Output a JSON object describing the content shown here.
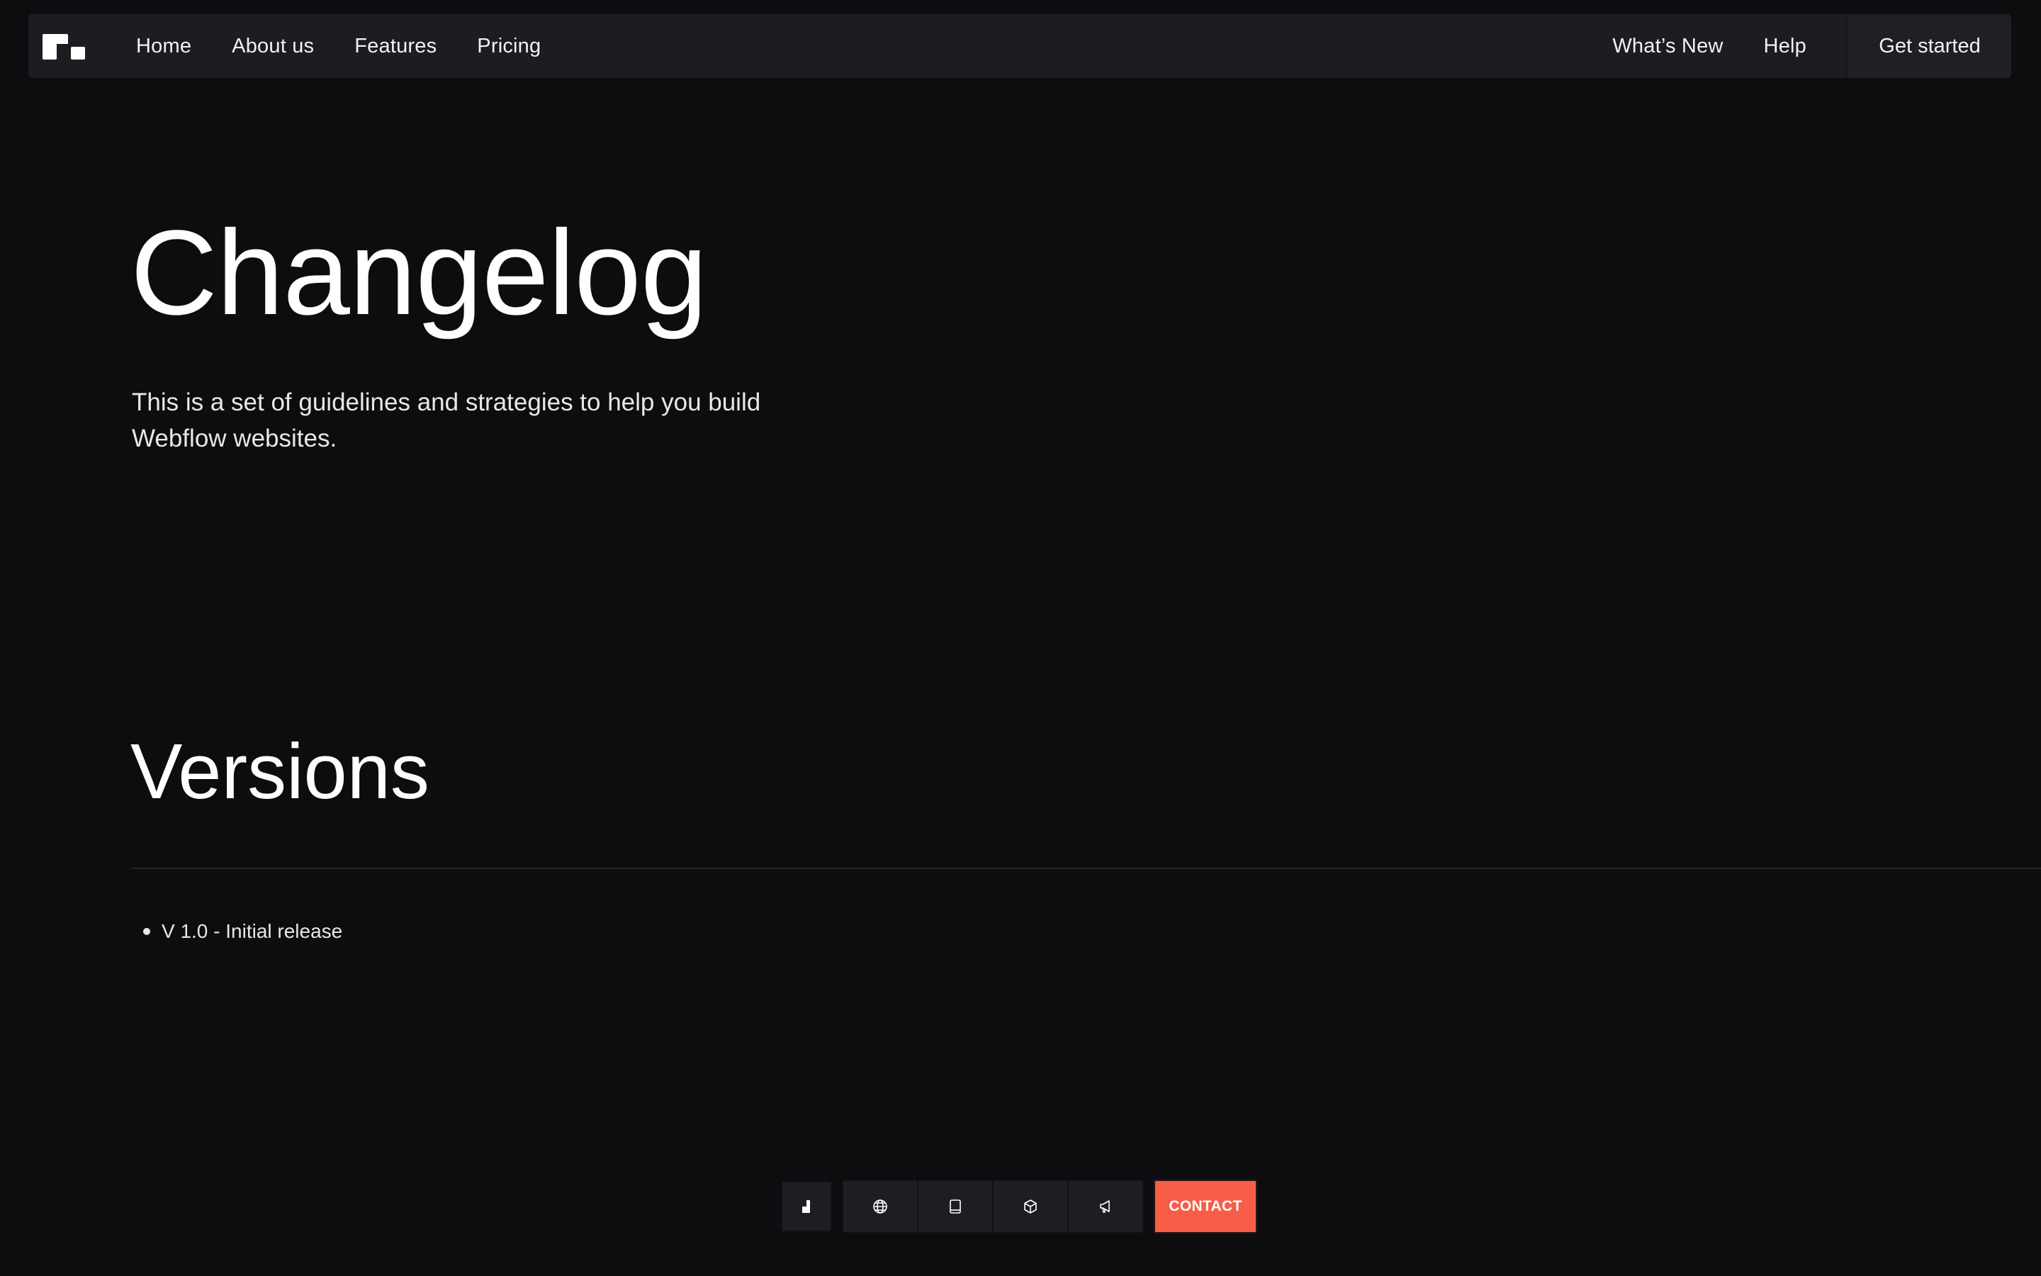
{
  "nav": {
    "left_links": [
      "Home",
      "About us",
      "Features",
      "Pricing"
    ],
    "whats_new": "What’s New",
    "help": "Help",
    "get_started": "Get started"
  },
  "hero": {
    "title": "Changelog",
    "subtitle_line1": "This is a set of guidelines and strategies to help you build",
    "subtitle_line2": "Webflow websites."
  },
  "versions": {
    "title": "Versions",
    "items": [
      "V 1.0 - Initial release"
    ]
  },
  "toolbar": {
    "icons": [
      "brand-mark-icon",
      "globe-icon",
      "tablet-icon",
      "cube-icon",
      "megaphone-icon"
    ],
    "contact_label": "CONTACT",
    "contact_color": "#f75d47"
  },
  "colors": {
    "hero_bg": "#1c1b1f",
    "page_bg": "#0d0d0f",
    "nav_bg": "#1d1c20"
  }
}
